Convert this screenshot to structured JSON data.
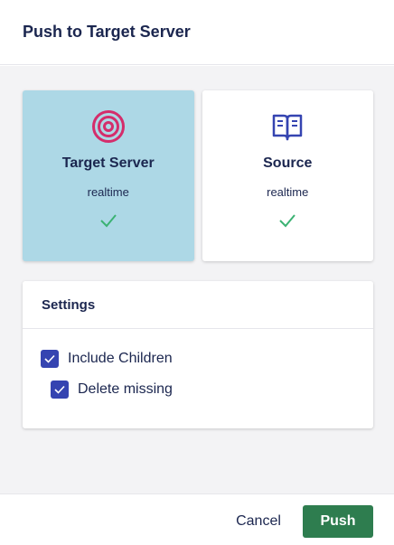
{
  "dialog": {
    "title": "Push to Target Server"
  },
  "cards": [
    {
      "title": "Target Server",
      "subtitle": "realtime",
      "icon": "target-icon",
      "selected": true
    },
    {
      "title": "Source",
      "subtitle": "realtime",
      "icon": "book-icon",
      "selected": false
    }
  ],
  "settings": {
    "title": "Settings",
    "options": [
      {
        "label": "Include Children",
        "checked": true
      },
      {
        "label": "Delete missing",
        "checked": true
      }
    ]
  },
  "footer": {
    "cancel_label": "Cancel",
    "push_label": "Push"
  },
  "colors": {
    "accent": "#3544b1",
    "selected_card": "#add8e6",
    "success": "#3bb273",
    "target_icon": "#d42d6b",
    "push_button": "#2e7d4f"
  }
}
